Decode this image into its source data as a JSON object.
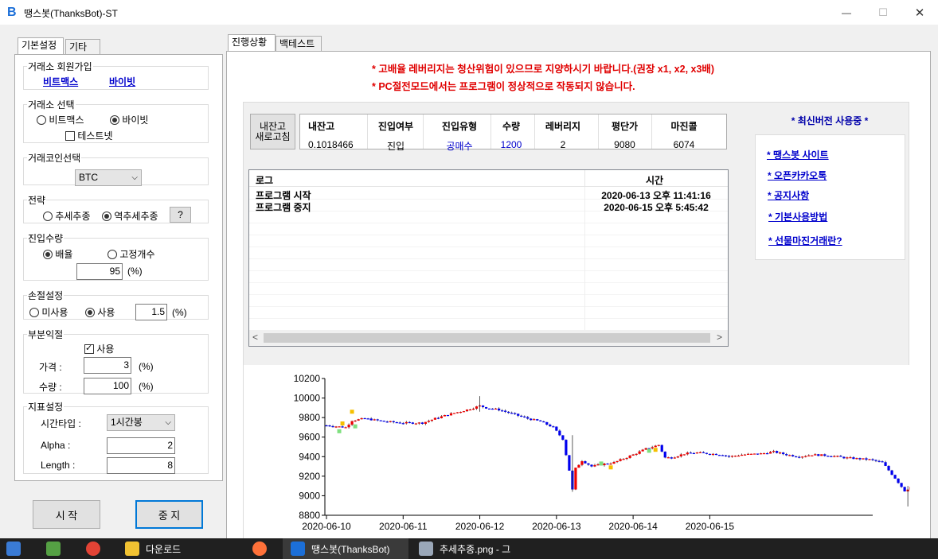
{
  "window": {
    "title": "땡스봇(ThanksBot)-ST",
    "logo_glyph": "B",
    "minimize_label": "—",
    "maximize_label": "☐",
    "close_label": "✕"
  },
  "left_tabs": [
    "기본설정",
    "기타"
  ],
  "right_tabs": [
    "진행상황",
    "백테스트"
  ],
  "exchange_join": {
    "legend": "거래소 회원가입",
    "links": [
      "비트맥스",
      "바이빗"
    ]
  },
  "exchange_select": {
    "legend": "거래소 선택",
    "options": [
      "비트맥스",
      "바이빗"
    ],
    "selected": "바이빗",
    "testnet_label": "테스트넷",
    "testnet_checked": false
  },
  "coin_select": {
    "legend": "거래코인선택",
    "value": "BTC"
  },
  "strategy": {
    "legend": "전략",
    "options": [
      "추세추종",
      "역추세추종"
    ],
    "selected": "역추세추종",
    "help_label": "?"
  },
  "entry_qty": {
    "legend": "진입수량",
    "options": [
      "배율",
      "고정개수"
    ],
    "selected": "배율",
    "value": "95",
    "unit": "(%)"
  },
  "stop_loss": {
    "legend": "손절설정",
    "options": [
      "미사용",
      "사용"
    ],
    "selected": "사용",
    "value": "1.5",
    "unit": "(%)"
  },
  "partial_profit": {
    "legend": "부분익절",
    "use_label": "사용",
    "use_checked": true,
    "price_label": "가격 :",
    "price_value": "3",
    "qty_label": "수량 :",
    "qty_value": "100",
    "unit": "(%)"
  },
  "indicator": {
    "legend": "지표설정",
    "timeframe_label": "시간타입 :",
    "timeframe_value": "1시간봉",
    "alpha_label": "Alpha :",
    "alpha_value": "2",
    "length_label": "Length :",
    "length_value": "8"
  },
  "buttons": {
    "start": "시 작",
    "stop": "중 지"
  },
  "warnings": [
    "* 고배율 레버리지는 청산위험이 있으므로 지양하시기 바랍니다.(권장 x1, x2, x3배)",
    "* PC절전모드에서는 프로그램이 정상적으로 작동되지 않습니다."
  ],
  "refresh_button": {
    "line1": "내잔고",
    "line2": "새로고침"
  },
  "position": {
    "headers": [
      "내잔고",
      "진입여부",
      "진입유형",
      "수량",
      "레버리지",
      "평단가",
      "마진콜"
    ],
    "values": [
      "0.1018466",
      "진입",
      "공매수",
      "1200",
      "2",
      "9080",
      "6074"
    ]
  },
  "log": {
    "headers": [
      "로그",
      "시간"
    ],
    "rows": [
      {
        "msg": "프로그램 시작",
        "time": "2020-06-13 오후 11:41:16"
      },
      {
        "msg": "프로그램 중지",
        "time": "2020-06-15 오후 5:45:42"
      }
    ],
    "scroll_left": "<",
    "scroll_right": ">"
  },
  "latest": {
    "title": "* 최신버전 사용중 *",
    "links": [
      "* 땡스봇 사이트",
      "* 오픈카카오톡",
      "* 공지사항",
      "* 기본사용방법",
      "* 선물마진거래란?"
    ]
  },
  "chart_data": {
    "type": "candlestick",
    "title": "",
    "xlabel": "",
    "ylabel": "",
    "ylim": [
      8800,
      10200
    ],
    "yticks": [
      "10200",
      "10000",
      "9800",
      "9600",
      "9400",
      "9200",
      "9000",
      "8800"
    ],
    "xticks": [
      "2020-06-10",
      "2020-06-11",
      "2020-06-12",
      "2020-06-13",
      "2020-06-14",
      "2020-06-15"
    ],
    "x_start": "2020-06-10 00:00",
    "interval": "1h",
    "up_color": "#ee0000",
    "down_color": "#0000ee",
    "anchors_close": [
      [
        0,
        9720
      ],
      [
        6,
        9700
      ],
      [
        8,
        9770
      ],
      [
        12,
        9790
      ],
      [
        18,
        9760
      ],
      [
        24,
        9745
      ],
      [
        30,
        9745
      ],
      [
        34,
        9790
      ],
      [
        38,
        9830
      ],
      [
        44,
        9880
      ],
      [
        48,
        9920
      ],
      [
        50,
        9900
      ],
      [
        54,
        9880
      ],
      [
        58,
        9840
      ],
      [
        63,
        9790
      ],
      [
        67,
        9760
      ],
      [
        71,
        9700
      ],
      [
        73,
        9620
      ],
      [
        74,
        9580
      ],
      [
        75,
        9420
      ],
      [
        76,
        9260
      ],
      [
        77,
        9060
      ],
      [
        78,
        9280
      ],
      [
        80,
        9360
      ],
      [
        83,
        9300
      ],
      [
        86,
        9320
      ],
      [
        90,
        9340
      ],
      [
        96,
        9420
      ],
      [
        100,
        9480
      ],
      [
        104,
        9520
      ],
      [
        106,
        9390
      ],
      [
        108,
        9390
      ],
      [
        112,
        9430
      ],
      [
        116,
        9440
      ],
      [
        120,
        9430
      ],
      [
        124,
        9420
      ],
      [
        126,
        9400
      ],
      [
        130,
        9420
      ],
      [
        136,
        9430
      ],
      [
        140,
        9450
      ],
      [
        144,
        9420
      ],
      [
        148,
        9400
      ],
      [
        152,
        9420
      ],
      [
        158,
        9410
      ],
      [
        162,
        9390
      ],
      [
        166,
        9380
      ],
      [
        170,
        9370
      ],
      [
        174,
        9340
      ],
      [
        178,
        9180
      ],
      [
        181,
        9050
      ],
      [
        183,
        9090
      ]
    ],
    "markers": [
      {
        "t": 4,
        "price": 9660,
        "color": "#7fe07f"
      },
      {
        "t": 5,
        "price": 9740,
        "color": "#f5c000"
      },
      {
        "t": 8,
        "price": 9860,
        "color": "#f5c000"
      },
      {
        "t": 9,
        "price": 9710,
        "color": "#7fe07f"
      },
      {
        "t": 86,
        "price": 9330,
        "color": "#7fe07f"
      },
      {
        "t": 89,
        "price": 9290,
        "color": "#f5c000"
      },
      {
        "t": 101,
        "price": 9460,
        "color": "#7fe07f"
      },
      {
        "t": 103,
        "price": 9470,
        "color": "#f5c000"
      }
    ]
  },
  "taskbar": {
    "items": [
      "다운로드",
      "땡스봇(ThanksBot)",
      "추세추종.png - 그"
    ]
  }
}
